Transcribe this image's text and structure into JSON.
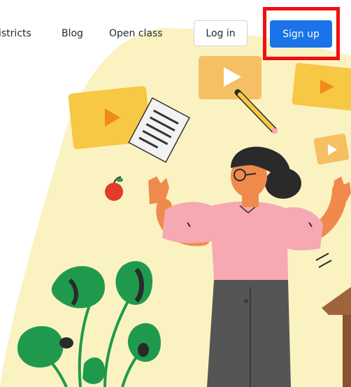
{
  "nav": {
    "links": [
      "istricts",
      "Blog",
      "Open class"
    ],
    "login_label": "Log in",
    "signup_label": "Sign up"
  },
  "colors": {
    "accent": "#1a73e8",
    "highlight": "#ee1111",
    "blob": "#fbf2c2",
    "video_yellow": "#f7c844",
    "shirt_pink": "#f6a9b3",
    "leaf_green": "#1f9a4c"
  },
  "illustration": {
    "icons": [
      "video-card-icon",
      "document-icon",
      "pencil-icon",
      "apple-icon",
      "monstera-plant-icon",
      "teacher-figure"
    ]
  }
}
